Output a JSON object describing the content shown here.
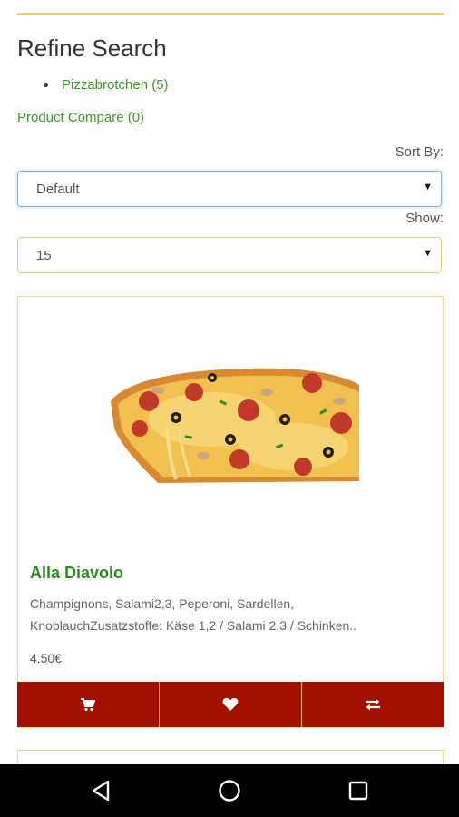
{
  "refine": {
    "title": "Refine Search",
    "items": [
      {
        "label": "Pizzabrotchen (5)"
      }
    ]
  },
  "compare": {
    "label": "Product Compare (0)"
  },
  "sort": {
    "label": "Sort By:",
    "value": "Default"
  },
  "show": {
    "label": "Show:",
    "value": "15"
  },
  "product": {
    "name": "Alla Diavolo",
    "description": "Champignons, Salami2,3, Peperoni, Sardellen, KnoblauchZusatzstoffe: Käse 1,2 / Salami 2,3 / Schinken..",
    "price": "4,50€",
    "image": "pizza-slice-photo",
    "actions": [
      {
        "icon": "cart-icon"
      },
      {
        "icon": "heart-icon"
      },
      {
        "icon": "compare-arrows-icon"
      }
    ]
  },
  "navigation": {
    "buttons": [
      {
        "icon": "back-triangle-icon"
      },
      {
        "icon": "home-circle-icon"
      },
      {
        "icon": "recents-square-icon"
      }
    ]
  },
  "colors": {
    "accent_green": "#3b9b28",
    "title_green": "#2c8a1f",
    "action_red": "#a31000",
    "border_gold": "#efd68a",
    "focus_blue": "#7fb6e6"
  }
}
